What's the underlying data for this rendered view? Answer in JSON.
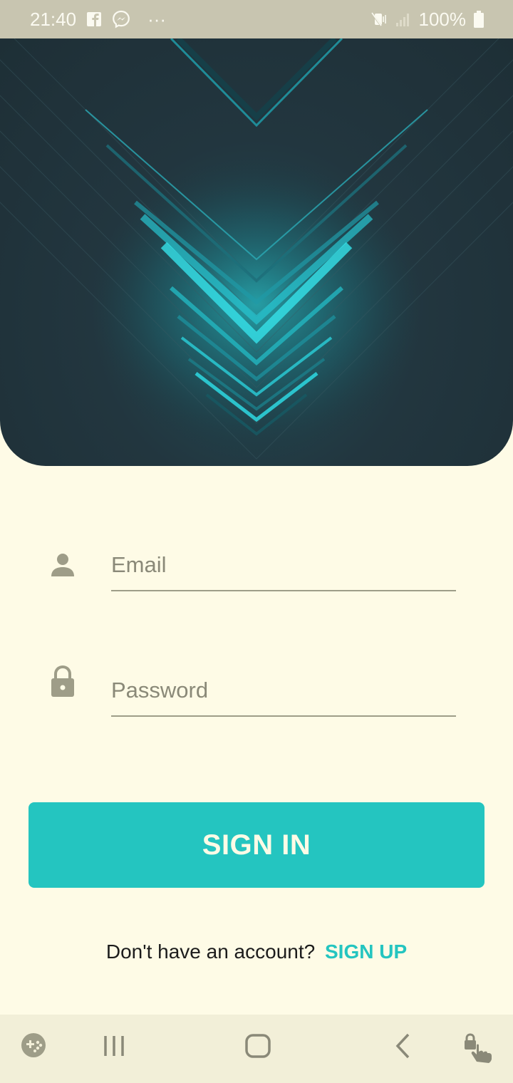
{
  "status_bar": {
    "time": "21:40",
    "more_indicator": "···",
    "battery_percent": "100%",
    "icons": [
      "facebook-icon",
      "messenger-icon",
      "mute-icon",
      "signal-icon",
      "battery-icon"
    ]
  },
  "form": {
    "email_placeholder": "Email",
    "email_value": "",
    "password_placeholder": "Password",
    "password_value": "",
    "sign_in_label": "SIGN IN",
    "no_account_text": "Don't have an account?",
    "sign_up_label": "SIGN UP"
  },
  "colors": {
    "background": "#fefbe6",
    "accent": "#24c5c0",
    "icon_gray": "#9e9d88",
    "hero_dark": "#22363f"
  },
  "nav_bar": {
    "icons": [
      "game-tools-icon",
      "recents-icon",
      "home-icon",
      "back-icon",
      "touch-lock-icon"
    ]
  }
}
